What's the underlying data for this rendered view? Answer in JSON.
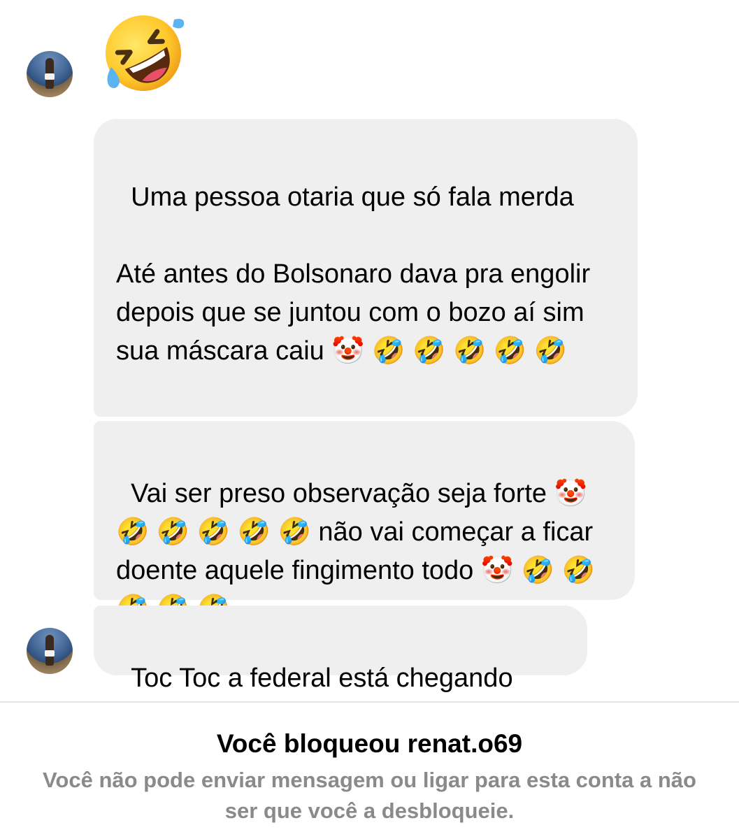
{
  "conversation": {
    "avatar_top_label": "contact avatar",
    "reaction_emoji": "rolling-on-floor-laughing",
    "messages": [
      {
        "text": "Uma pessoa otaria que só fala merda\n\nAté antes do Bolsonaro dava pra engolir  depois que se juntou com o bozo aí sim sua máscara caiu 🤡 🤣 🤣 🤣 🤣 🤣"
      },
      {
        "text": "Vai ser preso observação seja forte 🤡 🤣 🤣 🤣 🤣 🤣 não vai começar a ficar doente aquele fingimento todo 🤡 🤣 🤣 🤣 🤣 🤣"
      },
      {
        "text": "Toc Toc a federal está chegando"
      }
    ]
  },
  "blocked_notice": {
    "title": "Você bloqueou renat.o69",
    "subtitle": "Você não pode enviar mensagem ou ligar para esta conta a não ser que você a desbloqueie."
  },
  "colors": {
    "bubble_bg": "#efefef",
    "subtitle_gray": "#8a8a8a",
    "divider": "#e6e6e6"
  }
}
